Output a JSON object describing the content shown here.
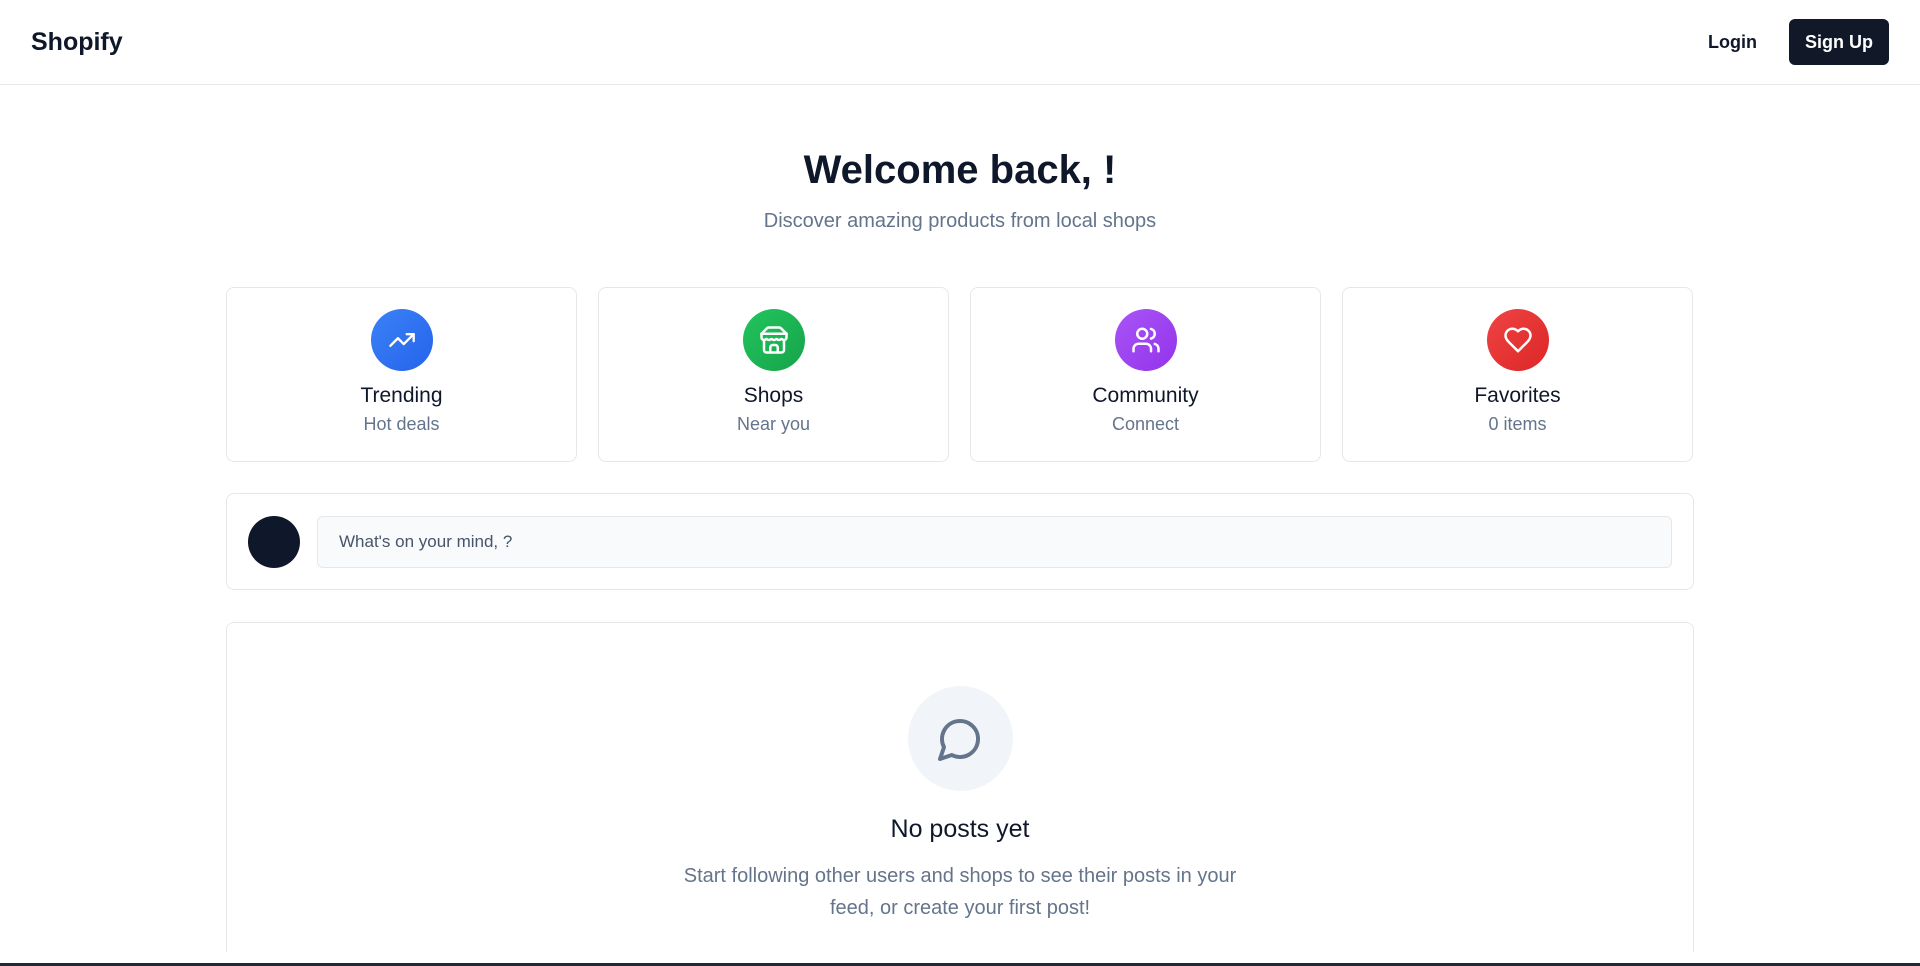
{
  "navbar": {
    "brand": "Shopify",
    "login_label": "Login",
    "signup_label": "Sign Up"
  },
  "hero": {
    "title": "Welcome back, !",
    "subtitle": "Discover amazing products from local shops"
  },
  "cards": [
    {
      "title": "Trending",
      "subtitle": "Hot deals",
      "icon": "trending-up-icon",
      "color_from": "#3b82f6",
      "color_to": "#2563eb"
    },
    {
      "title": "Shops",
      "subtitle": "Near you",
      "icon": "store-icon",
      "color_from": "#22c55e",
      "color_to": "#16a34a"
    },
    {
      "title": "Community",
      "subtitle": "Connect",
      "icon": "users-icon",
      "color_from": "#a855f7",
      "color_to": "#9333ea"
    },
    {
      "title": "Favorites",
      "subtitle": "0 items",
      "icon": "heart-icon",
      "color_from": "#ef4444",
      "color_to": "#dc2626"
    }
  ],
  "composer": {
    "placeholder": "What's on your mind, ?"
  },
  "feed": {
    "empty_icon": "message-circle-icon",
    "empty_title": "No posts yet",
    "empty_description": "Start following other users and shops to see their posts in your feed, or create your first post!"
  }
}
